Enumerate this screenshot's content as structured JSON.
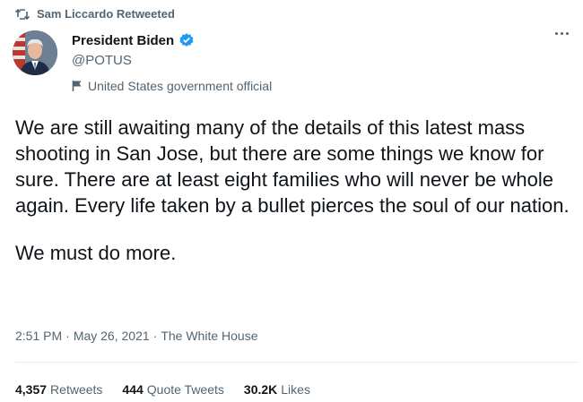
{
  "retweet": {
    "text": "Sam Liccardo Retweeted"
  },
  "author": {
    "name": "President Biden",
    "handle": "@POTUS",
    "label": "United States government official"
  },
  "tweet": {
    "paragraph1": "We are still awaiting many of the details of this latest mass shooting in San Jose, but there are some things we know for sure. There are at least eight families who will never be whole again. Every life taken by a bullet pierces the soul of our nation.",
    "paragraph2": "We must do more."
  },
  "meta": {
    "time": "2:51 PM",
    "date": "May 26, 2021",
    "source": "The White House",
    "separator": "·"
  },
  "stats": {
    "retweets_count": "4,357",
    "retweets_label": "Retweets",
    "quotes_count": "444",
    "quotes_label": "Quote Tweets",
    "likes_count": "30.2K",
    "likes_label": "Likes"
  },
  "colors": {
    "verified": "#1d9bf0",
    "secondary_text": "#536471"
  },
  "icons": {
    "retweet": "retweet-icon",
    "verified": "verified-badge-icon",
    "flag": "flag-icon",
    "more": "more-icon"
  }
}
